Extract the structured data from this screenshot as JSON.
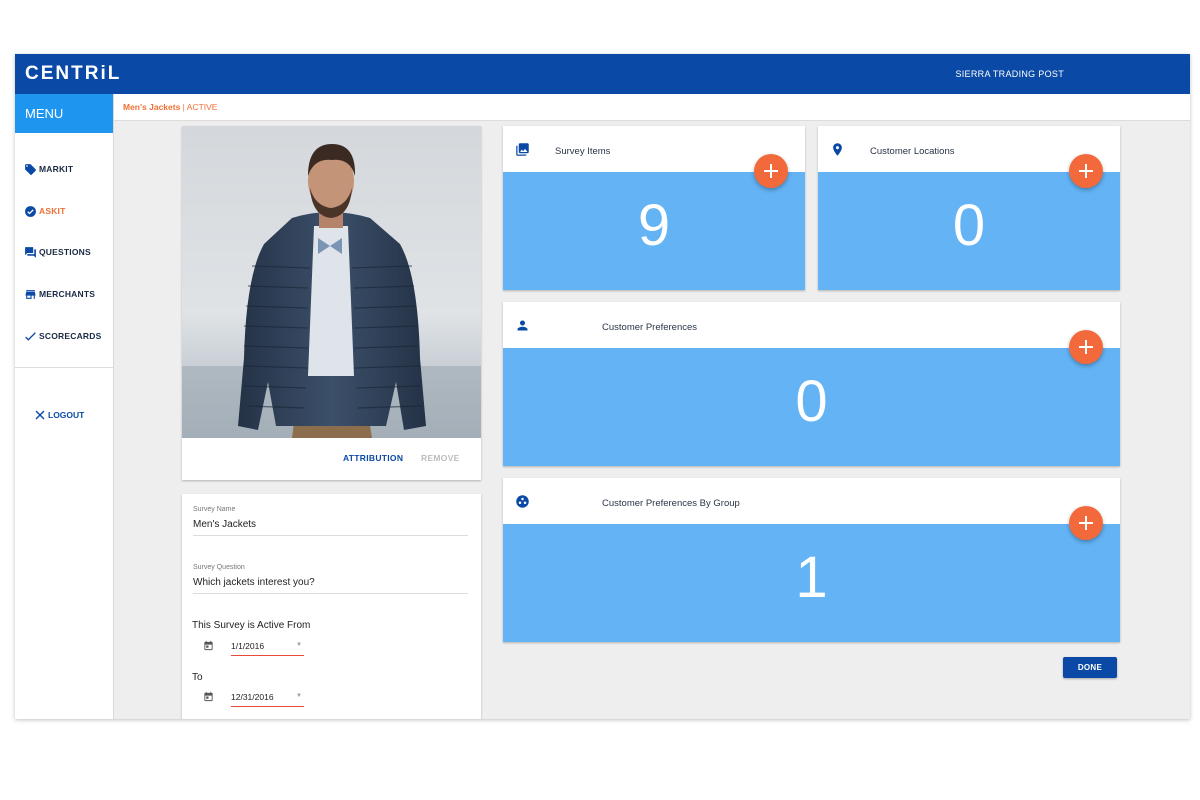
{
  "app": {
    "logo": "CENTRiL",
    "organization": "SIERRA TRADING POST"
  },
  "sidebar": {
    "menu_label": "MENU",
    "items": [
      {
        "label": "MARKIT",
        "icon": "tag-icon"
      },
      {
        "label": "ASKIT",
        "icon": "check-circle-icon",
        "active": true
      },
      {
        "label": "QUESTIONS",
        "icon": "forum-icon"
      },
      {
        "label": "MERCHANTS",
        "icon": "store-icon"
      },
      {
        "label": "SCORECARDS",
        "icon": "check-icon"
      }
    ],
    "logout_label": "LOGOUT"
  },
  "breadcrumb": {
    "name": "Men's Jackets",
    "status": " | ACTIVE"
  },
  "photo": {
    "attribution_label": "ATTRIBUTION",
    "remove_label": "REMOVE"
  },
  "form": {
    "survey_name_label": "Survey Name",
    "survey_name_value": "Men's Jackets",
    "survey_question_label": "Survey Question",
    "survey_question_value": "Which jackets interest you?",
    "active_from_label": "This Survey is Active From",
    "from_date": "1/1/2016",
    "to_label": "To",
    "to_date": "12/31/2016"
  },
  "tiles": {
    "survey_items": {
      "title": "Survey Items",
      "count": "9",
      "icon": "photo-library-icon"
    },
    "customer_locations": {
      "title": "Customer Locations",
      "count": "0",
      "icon": "location-pin-icon"
    },
    "customer_preferences": {
      "title": "Customer Preferences",
      "count": "0",
      "icon": "person-icon"
    },
    "customer_preferences_group": {
      "title": "Customer Preferences By Group",
      "count": "1",
      "icon": "group-work-icon"
    }
  },
  "done_label": "DONE",
  "colors": {
    "primary": "#0a4aa6",
    "menu": "#1e96f0",
    "accent": "#f26a3c",
    "tile": "#63b3f5",
    "active_nav": "#f07035"
  }
}
